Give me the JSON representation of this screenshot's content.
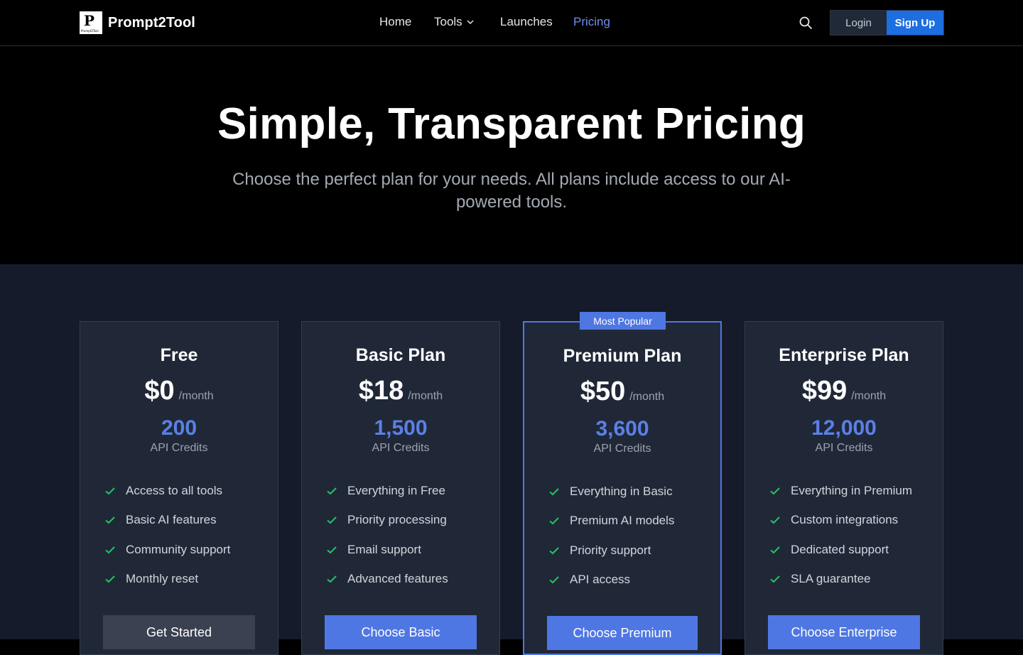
{
  "brand": {
    "name": "Prompt2Tool",
    "logo_letter": "P",
    "logo_small": "Prompt2Tool"
  },
  "nav": {
    "home": "Home",
    "tools": "Tools",
    "launches": "Launches",
    "pricing": "Pricing"
  },
  "auth": {
    "login": "Login",
    "signup": "Sign Up"
  },
  "hero": {
    "title": "Simple, Transparent Pricing",
    "subtitle": "Choose the perfect plan for your needs. All plans include access to our AI-powered tools."
  },
  "colors": {
    "accent": "#4f77e3",
    "check": "#22c55e",
    "active_nav": "#6d8ef0",
    "signup": "#1d6ee0"
  },
  "plans": [
    {
      "name": "Free",
      "price": "$0",
      "period": "/month",
      "credits": "200",
      "credits_label": "API Credits",
      "features": [
        "Access to all tools",
        "Basic AI features",
        "Community support",
        "Monthly reset"
      ],
      "cta": "Get Started"
    },
    {
      "name": "Basic Plan",
      "price": "$18",
      "period": "/month",
      "credits": "1,500",
      "credits_label": "API Credits",
      "features": [
        "Everything in Free",
        "Priority processing",
        "Email support",
        "Advanced features"
      ],
      "cta": "Choose Basic"
    },
    {
      "name": "Premium Plan",
      "price": "$50",
      "period": "/month",
      "credits": "3,600",
      "credits_label": "API Credits",
      "badge": "Most Popular",
      "features": [
        "Everything in Basic",
        "Premium AI models",
        "Priority support",
        "API access"
      ],
      "cta": "Choose Premium"
    },
    {
      "name": "Enterprise Plan",
      "price": "$99",
      "period": "/month",
      "credits": "12,000",
      "credits_label": "API Credits",
      "features": [
        "Everything in Premium",
        "Custom integrations",
        "Dedicated support",
        "SLA guarantee"
      ],
      "cta": "Choose Enterprise"
    }
  ]
}
